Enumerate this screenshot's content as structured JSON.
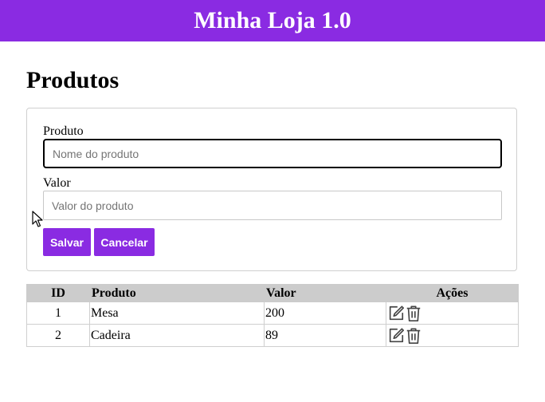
{
  "header": {
    "title": "Minha Loja 1.0"
  },
  "page": {
    "title": "Produtos"
  },
  "form": {
    "product_label": "Produto",
    "product_placeholder": "Nome do produto",
    "product_value": "",
    "value_label": "Valor",
    "value_placeholder": "Valor do produto",
    "value_value": "",
    "save_label": "Salvar",
    "cancel_label": "Cancelar"
  },
  "table": {
    "headers": [
      "ID",
      "Produto",
      "Valor",
      "Ações"
    ],
    "rows": [
      {
        "id": "1",
        "name": "Mesa",
        "value": "200",
        "actions": [
          "edit-icon",
          "trash-icon"
        ]
      },
      {
        "id": "2",
        "name": "Cadeira",
        "value": "89",
        "actions": [
          "edit-icon",
          "trash-icon"
        ]
      }
    ]
  },
  "colors": {
    "brand": "#8a2be2",
    "table_header_bg": "#cccccc"
  }
}
